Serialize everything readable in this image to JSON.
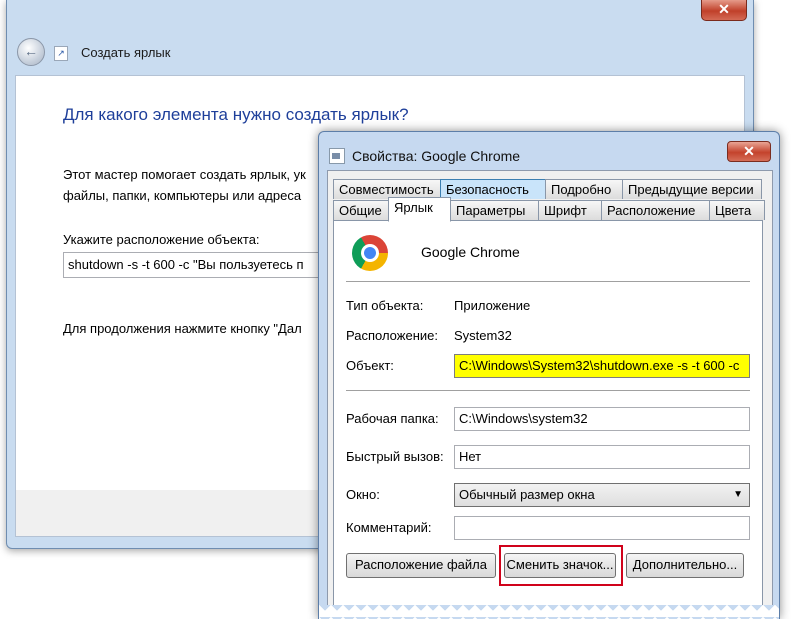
{
  "wizard": {
    "close_glyph": "✕",
    "back_glyph": "←",
    "title": "Создать ярлык",
    "heading": "Для какого элемента нужно создать ярлык?",
    "intro_line1": "Этот мастер помогает создать ярлык, ук",
    "intro_line2": "файлы, папки, компьютеры или адреса",
    "location_label": "Укажите расположение объекта:",
    "location_value": "shutdown -s -t 600 -c \"Вы пользуетесь п",
    "continue_text": "Для продолжения нажмите кнопку \"Дал"
  },
  "properties": {
    "title": "Свойства: Google Chrome",
    "close_glyph": "✕",
    "tabs_row1": [
      "Совместимость",
      "Безопасность",
      "Подробно",
      "Предыдущие версии"
    ],
    "tabs_row2": [
      "Общие",
      "Ярлык",
      "Параметры",
      "Шрифт",
      "Расположение",
      "Цвета"
    ],
    "active_tab": "Ярлык",
    "app_name": "Google Chrome",
    "type_label": "Тип объекта:",
    "type_value": "Приложение",
    "location_label": "Расположение:",
    "location_value": "System32",
    "target_label": "Объект:",
    "target_value": "C:\\Windows\\System32\\shutdown.exe -s -t 600 -c",
    "workdir_label": "Рабочая папка:",
    "workdir_value": "C:\\Windows\\system32",
    "hotkey_label": "Быстрый вызов:",
    "hotkey_value": "Нет",
    "window_label": "Окно:",
    "window_value": "Обычный размер окна",
    "window_arrow": "▼",
    "comment_label": "Комментарий:",
    "comment_value": "",
    "buttons": {
      "open_location": "Расположение файла",
      "change_icon": "Сменить значок...",
      "advanced": "Дополнительно..."
    }
  },
  "colors": {
    "target_highlight": "#ffff00",
    "button_highlight": "#d0021b",
    "heading_blue": "#1e3f9a"
  }
}
